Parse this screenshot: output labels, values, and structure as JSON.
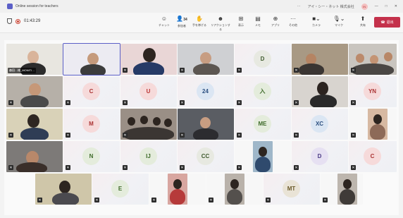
{
  "titlebar": {
    "title": "Online session for teachers",
    "user_label": "アイ・シー・ネット 株式会社",
    "avatar_initials": "IN"
  },
  "toolbar": {
    "timer": "01:43:29",
    "buttons": [
      {
        "icon": "chat-icon",
        "label": "チャット"
      },
      {
        "icon": "people-icon",
        "label": "参加者",
        "count": "34"
      },
      {
        "icon": "raise-hand-icon",
        "label": "手を挙げる"
      },
      {
        "icon": "reaction-icon",
        "label": "リアクションする"
      },
      {
        "icon": "view-icon",
        "label": "表示"
      },
      {
        "icon": "notes-icon",
        "label": "メモ"
      },
      {
        "icon": "apps-icon",
        "label": "アプリ"
      },
      {
        "icon": "more-icon",
        "label": "その他"
      },
      {
        "icon": "camera-icon",
        "label": "カメラ"
      },
      {
        "icon": "mic-icon",
        "label": "マイク"
      },
      {
        "icon": "share-icon",
        "label": "共有"
      }
    ],
    "leave_label": "退出"
  },
  "participants": {
    "self_name": "森田…様_MONITI…",
    "initials": [
      "D",
      "C",
      "U",
      "24",
      "入",
      "YN",
      "M",
      "ME",
      "XC",
      "N",
      "IJ",
      "CC",
      "D",
      "C",
      "E",
      "MT"
    ]
  },
  "colors": {
    "accent": "#5b5fc7",
    "leave": "#c4314b"
  }
}
